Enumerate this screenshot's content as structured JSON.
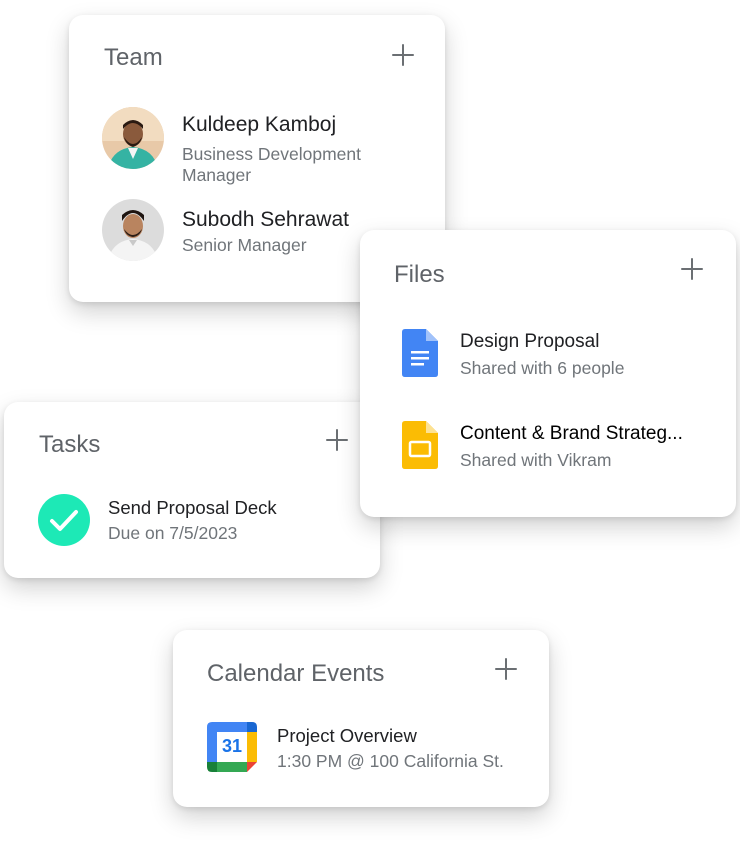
{
  "team": {
    "title": "Team",
    "members": [
      {
        "name": "Kuldeep Kamboj",
        "role_line1": "Business Development",
        "role_line2": "Manager"
      },
      {
        "name": "Subodh Sehrawat",
        "role_line1": "Senior Manager"
      }
    ]
  },
  "files": {
    "title": "Files",
    "items": [
      {
        "name": "Design Proposal",
        "shared": "Shared with 6 people",
        "icon": "google-docs-icon"
      },
      {
        "name": "Content & Brand Strateg...",
        "shared": "Shared with Vikram",
        "icon": "google-slides-icon"
      }
    ]
  },
  "tasks": {
    "title": "Tasks",
    "items": [
      {
        "title": "Send Proposal Deck",
        "due": "Due on 7/5/2023",
        "icon": "check-circle-icon"
      }
    ]
  },
  "calendar": {
    "title": "Calendar Events",
    "events": [
      {
        "title": "Project Overview",
        "details": "1:30 PM @ 100 California St.",
        "icon": "google-calendar-icon",
        "icon_text": "31"
      }
    ]
  },
  "colors": {
    "docs_blue": "#4285F4",
    "slides_yellow": "#FBBC04",
    "task_check": "#1DE9B6",
    "title_gray": "#5f6368",
    "text_dark": "#202124",
    "text_gray": "#70757a"
  }
}
